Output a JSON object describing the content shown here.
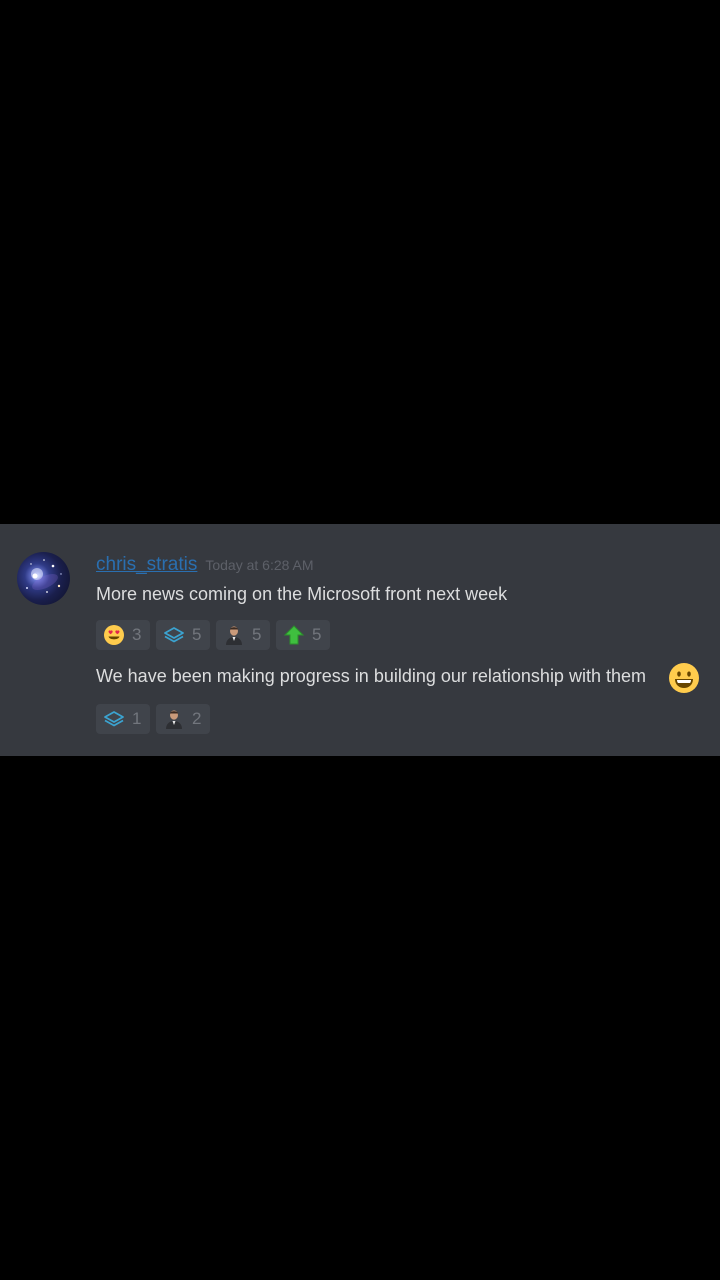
{
  "message": {
    "author": "chris_stratis",
    "timestamp": "Today at 6:28 AM",
    "avatar_icon": "galaxy-avatar-icon",
    "username_color": "#2a6fb0",
    "panel_color": "#36393f",
    "lines": [
      {
        "text": "More news coming on the Microsoft front next week",
        "reactions": [
          {
            "icon": "heart-eyes-emoji-icon",
            "count": "3"
          },
          {
            "icon": "layers-icon",
            "count": "5"
          },
          {
            "icon": "person-emoji-icon",
            "count": "5"
          },
          {
            "icon": "green-up-arrow-icon",
            "count": "5"
          }
        ]
      },
      {
        "text": "We have been making progress in building our relationship with them",
        "trailing_emoji": "grinning-face-emoji-icon",
        "reactions": [
          {
            "icon": "layers-icon",
            "count": "1"
          },
          {
            "icon": "person-emoji-icon",
            "count": "2"
          }
        ]
      }
    ]
  }
}
